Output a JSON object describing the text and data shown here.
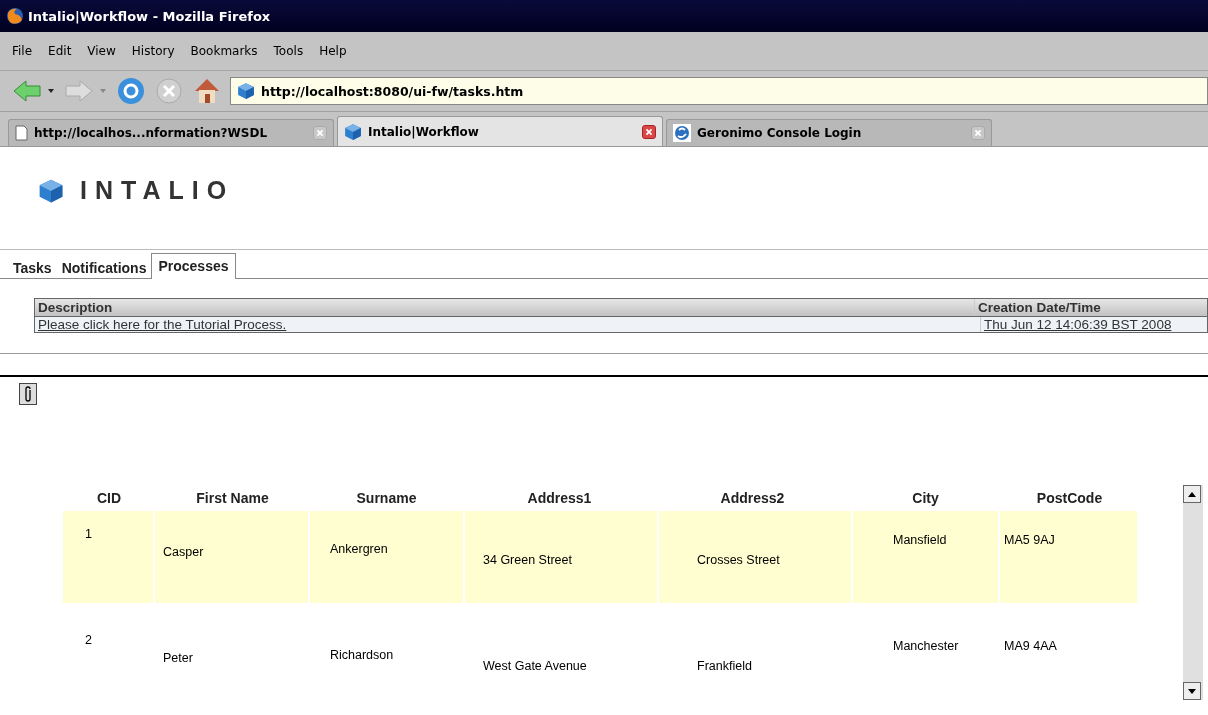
{
  "window": {
    "title": "Intalio|Workflow - Mozilla Firefox"
  },
  "menu": [
    "File",
    "Edit",
    "View",
    "History",
    "Bookmarks",
    "Tools",
    "Help"
  ],
  "toolbar": {
    "url": "http://localhost:8080/ui-fw/tasks.htm"
  },
  "browser_tabs": [
    {
      "title": "http://localhos...nformation?WSDL",
      "kind": "page",
      "selected": false
    },
    {
      "title": "Intalio|Workflow",
      "kind": "cube",
      "selected": true
    },
    {
      "title": "Geronimo Console Login",
      "kind": "geronimo",
      "selected": false
    }
  ],
  "logo": {
    "text": "INTALIO"
  },
  "portal_tabs": [
    {
      "label": "Tasks",
      "selected": false
    },
    {
      "label": "Notifications",
      "selected": false
    },
    {
      "label": "Processes",
      "selected": true
    }
  ],
  "process_table": {
    "columns": [
      "Description",
      "Creation Date/Time"
    ],
    "rows": [
      [
        "Please click here for the Tutorial Process.",
        "Thu Jun 12 14:06:39 BST 2008"
      ]
    ]
  },
  "grid": {
    "columns": [
      "CID",
      "First Name",
      "Surname",
      "Address1",
      "Address2",
      "City",
      "PostCode"
    ],
    "rows": [
      {
        "selected": true,
        "cells": [
          "1",
          "Casper",
          "Ankergren",
          "34 Green Street",
          "Crosses Street",
          "Mansfield",
          "MA5 9AJ"
        ]
      },
      {
        "selected": false,
        "cells": [
          "2",
          "Peter",
          "Richardson",
          "West Gate Avenue",
          "Frankfield",
          "Manchester",
          "MA9 4AA"
        ]
      }
    ]
  }
}
